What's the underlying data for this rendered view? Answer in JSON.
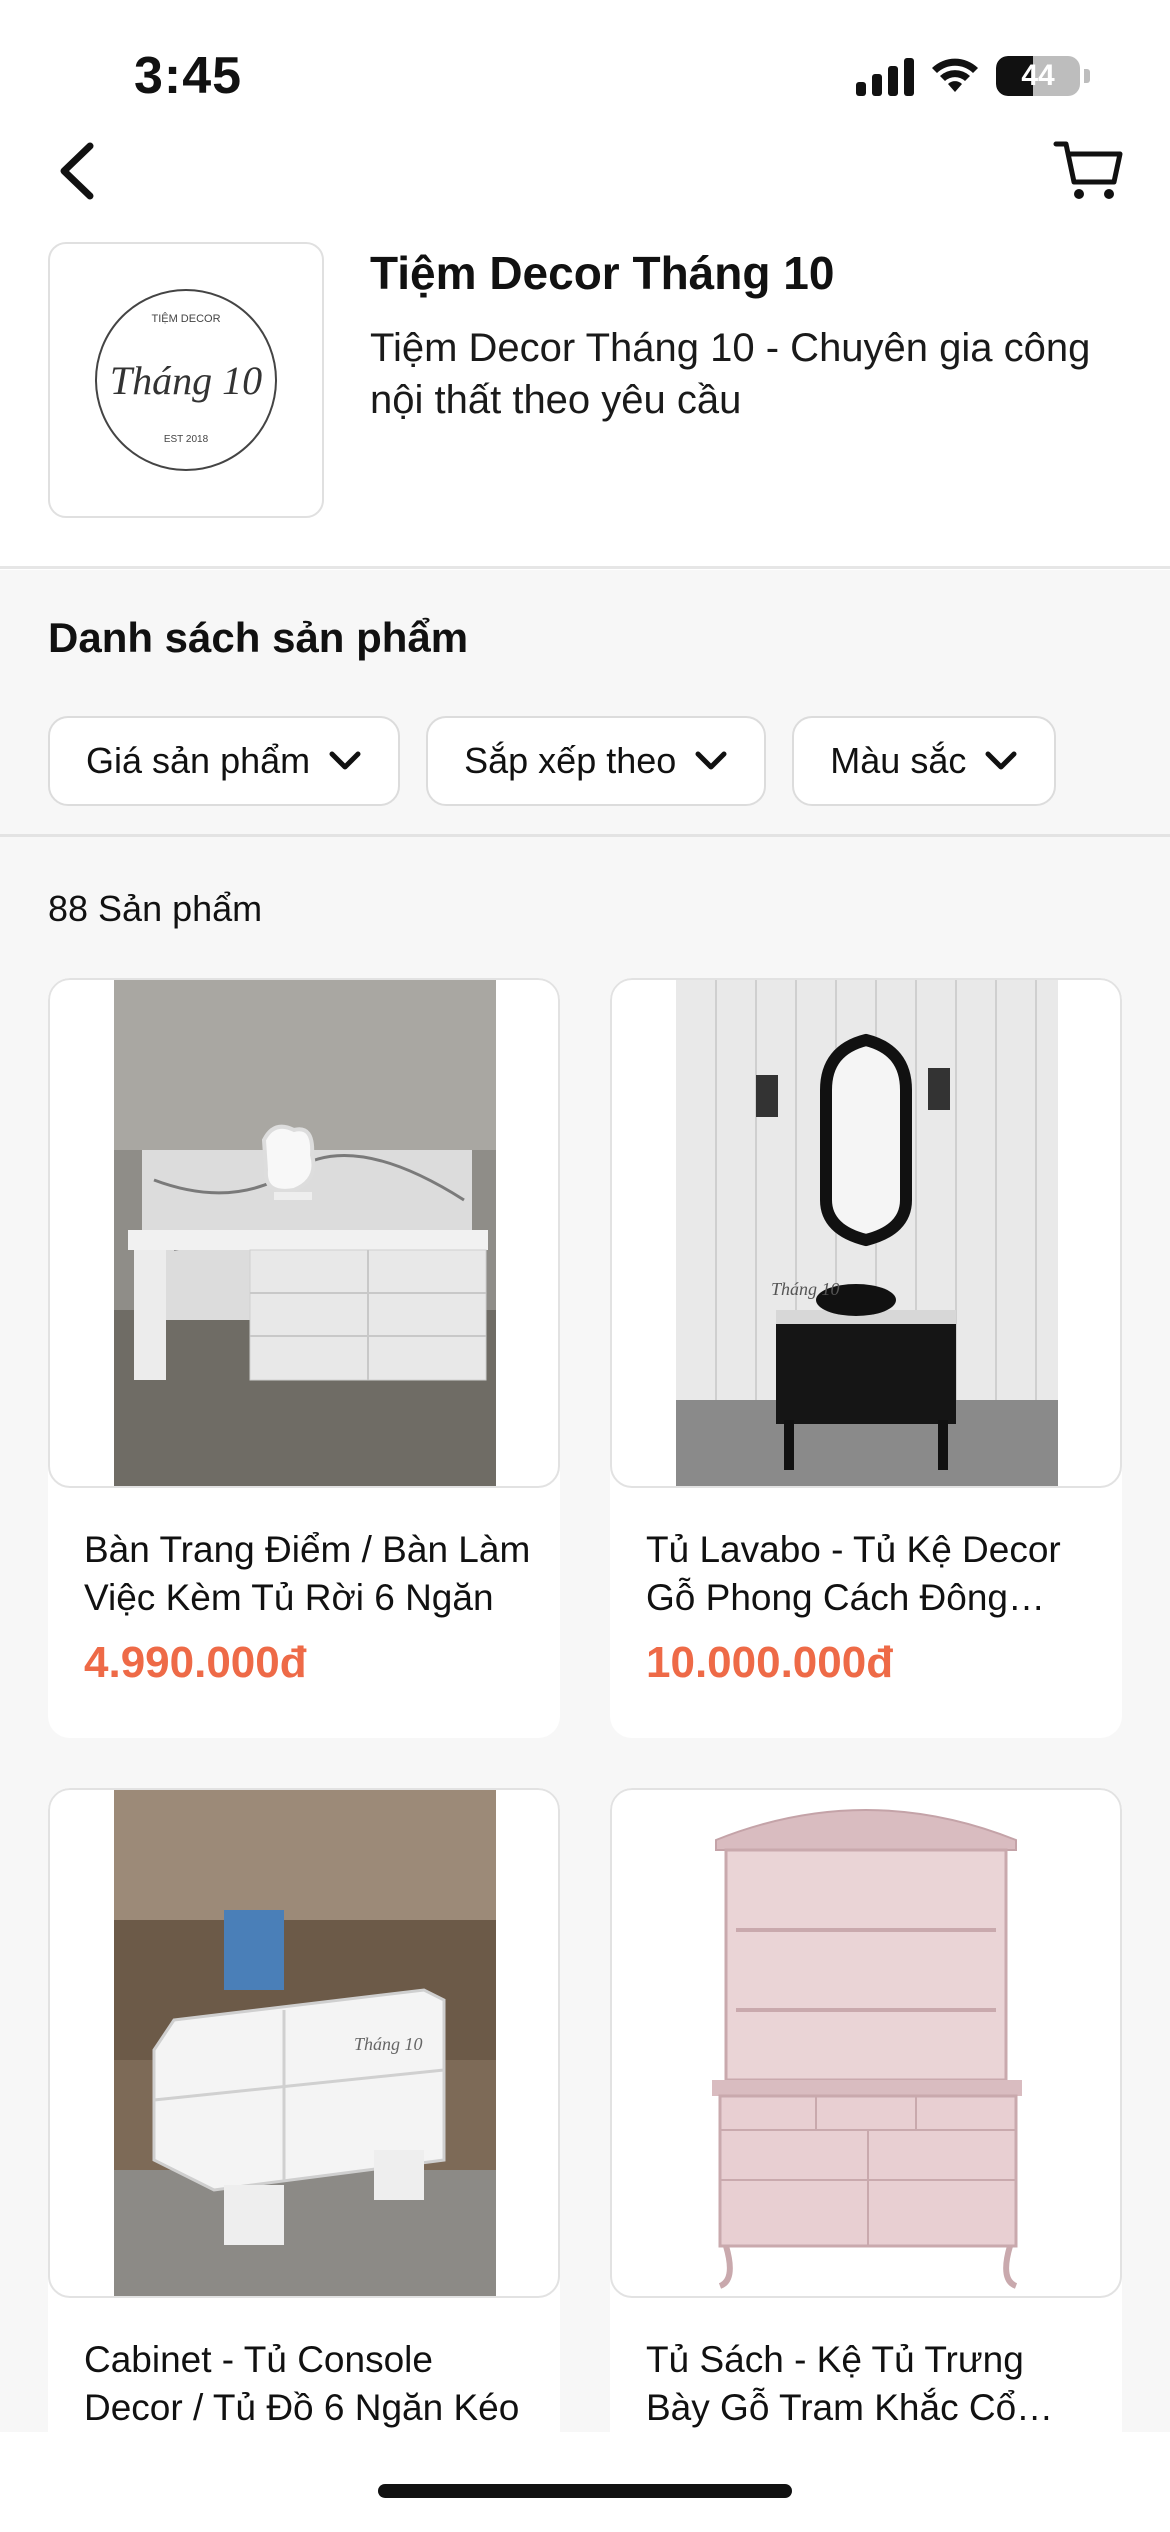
{
  "status_bar": {
    "time": "3:45",
    "battery": "44",
    "battery_level": 0.44
  },
  "nav": {
    "back_icon": "chevron-left-icon",
    "cart_icon": "cart-icon"
  },
  "shop": {
    "logo_text_top": "TIỆM DECOR",
    "logo_script": "Tháng 10",
    "logo_text_bottom": "EST 2018",
    "name": "Tiệm Decor Tháng 10",
    "description": "Tiệm Decor Tháng 10 - Chuyên gia công nội thất theo yêu cầu"
  },
  "products_section": {
    "title": "Danh sách sản phẩm",
    "filters": [
      {
        "label": "Giá sản phẩm",
        "icon": "chevron-down-icon"
      },
      {
        "label": "Sắp xếp theo",
        "icon": "chevron-down-icon"
      },
      {
        "label": "Màu sắc",
        "icon": "chevron-down-icon"
      }
    ],
    "count_label": "88 Sản phẩm",
    "items": [
      {
        "title": "Bàn Trang Điểm / Bàn Làm Việc Kèm Tủ Rời 6 Ngăn",
        "price": "4.990.000đ"
      },
      {
        "title": "Tủ Lavabo - Tủ Kệ Decor Gỗ Phong Cách Đông Dương",
        "price": "10.000.000đ"
      },
      {
        "title": "Cabinet - Tủ Console Decor / Tủ Đồ 6 Ngăn Kéo",
        "price": ""
      },
      {
        "title": "Tủ Sách - Kệ Tủ Trưng Bày Gỗ Tram Khắc Cổ Điển",
        "price": ""
      }
    ]
  },
  "colors": {
    "price": "#ee6a47",
    "section_bg": "#f7f7f7"
  }
}
